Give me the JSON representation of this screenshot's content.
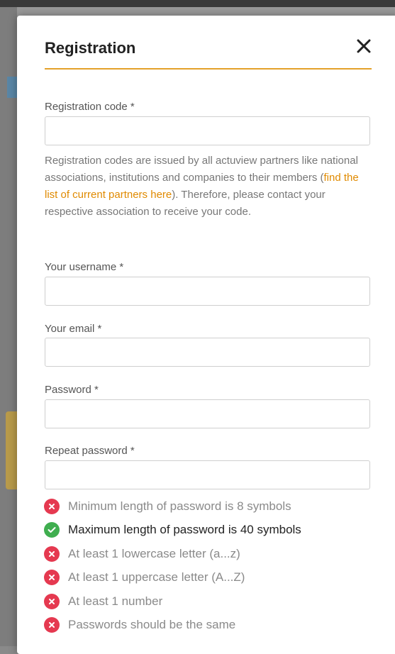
{
  "colors": {
    "accent": "#e4a12a",
    "link": "#e08a00",
    "error": "#e53950",
    "success": "#3fae4f"
  },
  "modal": {
    "title": "Registration",
    "close_icon": "close-icon",
    "registration_code": {
      "label": "Registration code *",
      "value": "",
      "placeholder": ""
    },
    "help": {
      "before": "Registration codes are issued by all actuview partners like national associations, institutions and companies to their members (",
      "link": "find the list of current partners here",
      "after": "). Therefore, please contact your respective association to receive your code."
    },
    "username": {
      "label": "Your username *",
      "value": "",
      "placeholder": ""
    },
    "email": {
      "label": "Your email *",
      "value": "",
      "placeholder": ""
    },
    "password": {
      "label": "Password *",
      "value": "",
      "placeholder": ""
    },
    "repeat_password": {
      "label": "Repeat password *",
      "value": "",
      "placeholder": ""
    },
    "rules": [
      {
        "text": "Minimum length of password is 8 symbols",
        "status": "invalid",
        "icon": "error-icon"
      },
      {
        "text": "Maximum length of password is 40 symbols",
        "status": "valid",
        "icon": "check-icon"
      },
      {
        "text": "At least 1 lowercase letter (a...z)",
        "status": "invalid",
        "icon": "error-icon"
      },
      {
        "text": "At least 1 uppercase letter (A...Z)",
        "status": "invalid",
        "icon": "error-icon"
      },
      {
        "text": "At least 1 number",
        "status": "invalid",
        "icon": "error-icon"
      },
      {
        "text": "Passwords should be the same",
        "status": "invalid",
        "icon": "error-icon"
      }
    ]
  }
}
